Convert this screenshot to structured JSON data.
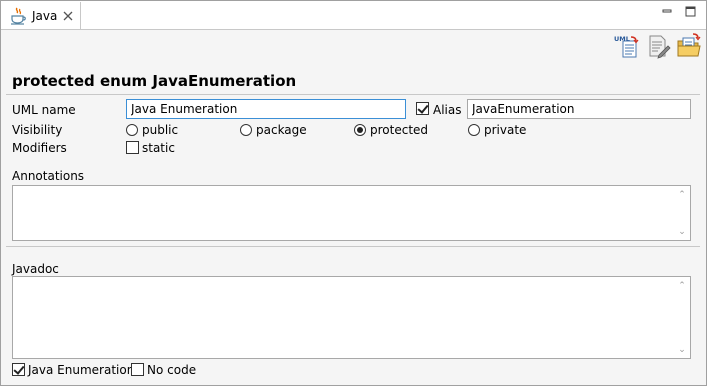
{
  "tab": {
    "title": "Java",
    "icon": "java-cup-icon",
    "close_icon": "close-icon"
  },
  "window_controls": {
    "minimize_icon": "minimize-icon",
    "maximize_icon": "maximize-icon"
  },
  "toolbar": {
    "uml_label": "UML",
    "icons": [
      "uml-export-icon",
      "edit-document-icon",
      "open-folder-icon"
    ]
  },
  "header": {
    "title": "protected enum JavaEnumeration"
  },
  "form": {
    "uml_name_label": "UML name",
    "uml_name_value": "Java Enumeration",
    "alias_label": "Alias",
    "alias_checked": true,
    "alias_value": "JavaEnumeration",
    "visibility_label": "Visibility",
    "visibility_options": [
      "public",
      "package",
      "protected",
      "private"
    ],
    "visibility_selected": "protected",
    "modifiers_label": "Modifiers",
    "modifier_static": "static",
    "annotations_label": "Annotations",
    "javadoc_label": "Javadoc"
  },
  "footer": {
    "java_enum_label": "Java Enumeration",
    "java_enum_checked": true,
    "no_code_label": "No code",
    "no_code_checked": false
  },
  "colors": {
    "focus_border": "#3b8fd6",
    "background": "#f5f5f5"
  }
}
